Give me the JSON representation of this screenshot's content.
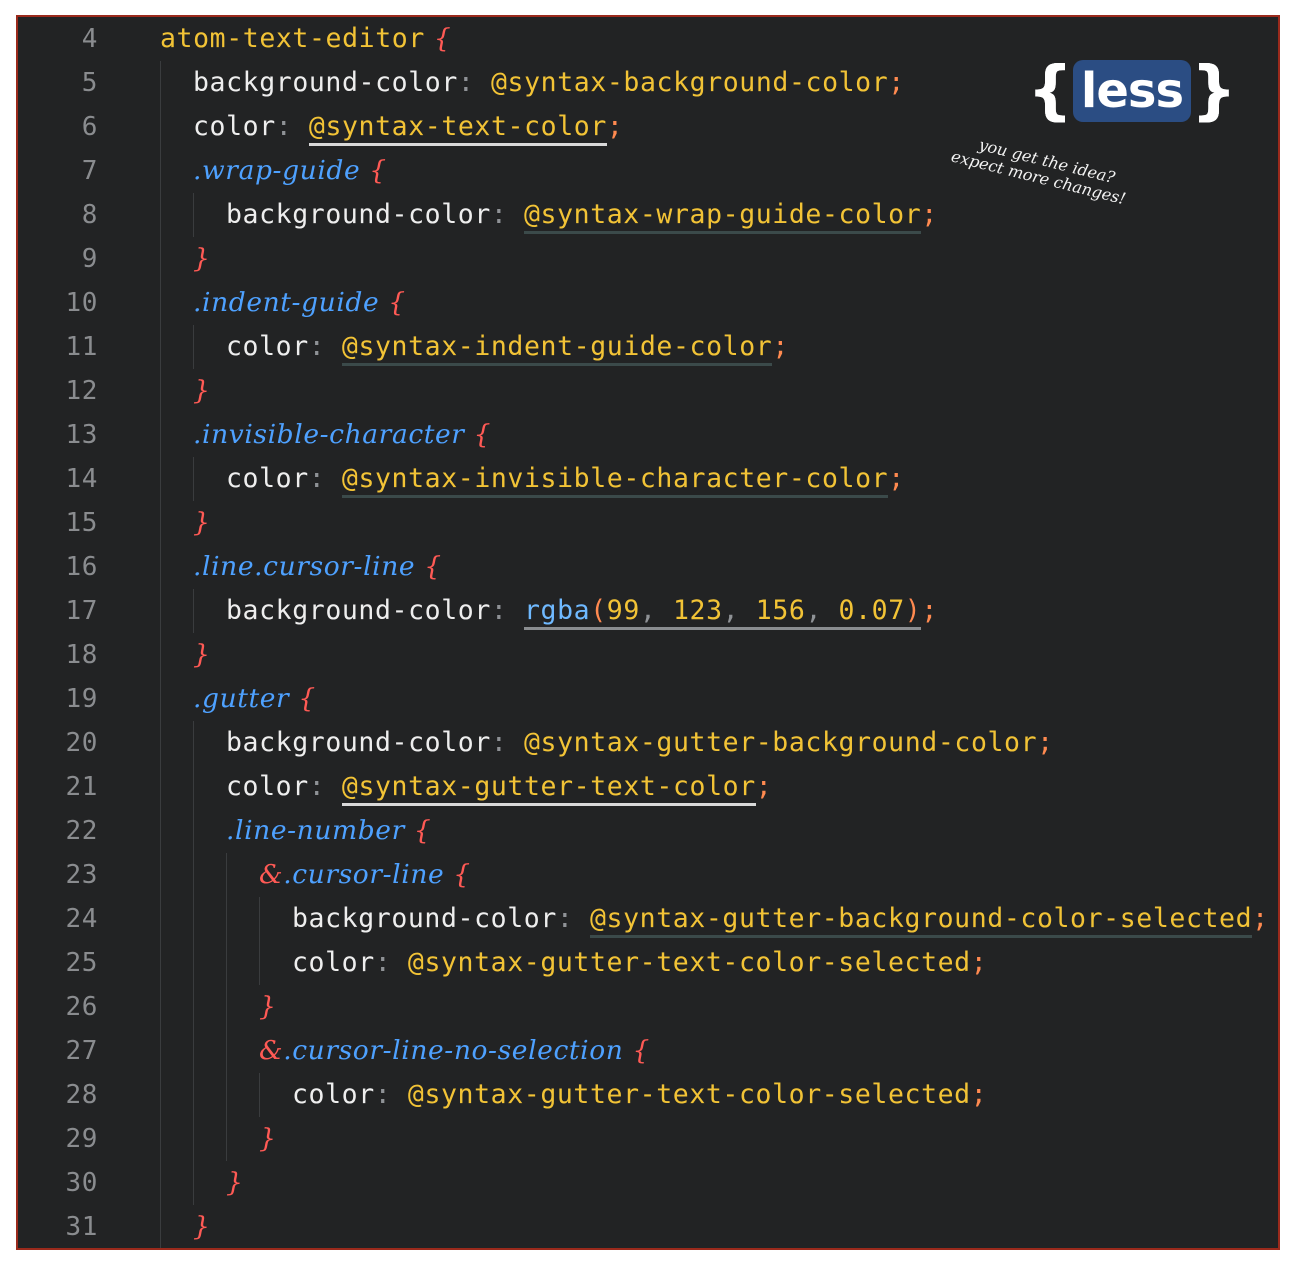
{
  "editor": {
    "lines": [
      {
        "n": "4",
        "indent": 0,
        "tokens": [
          [
            "prop-var",
            "atom-text-editor"
          ],
          [
            "brace",
            " {"
          ]
        ]
      },
      {
        "n": "5",
        "indent": 1,
        "tokens": [
          [
            "prop",
            "background-color"
          ],
          [
            "punc",
            ": "
          ],
          [
            "var",
            "@syntax-background-color"
          ],
          [
            "semi",
            ";"
          ]
        ]
      },
      {
        "n": "6",
        "indent": 1,
        "tokens": [
          [
            "prop",
            "color"
          ],
          [
            "punc",
            ": "
          ],
          [
            "var ul-white",
            "@syntax-text-color"
          ],
          [
            "semi",
            ";"
          ]
        ]
      },
      {
        "n": "7",
        "indent": 1,
        "tokens": [
          [
            "sel",
            ".wrap-guide"
          ],
          [
            "brace",
            " {"
          ]
        ]
      },
      {
        "n": "8",
        "indent": 2,
        "tokens": [
          [
            "prop",
            "background-color"
          ],
          [
            "punc",
            ": "
          ],
          [
            "var ul-dark",
            "@syntax-wrap-guide-color"
          ],
          [
            "semi",
            ";"
          ]
        ]
      },
      {
        "n": "9",
        "indent": 1,
        "tokens": [
          [
            "brace",
            "}"
          ]
        ]
      },
      {
        "n": "10",
        "indent": 1,
        "tokens": [
          [
            "sel",
            ".indent-guide"
          ],
          [
            "brace",
            " {"
          ]
        ]
      },
      {
        "n": "11",
        "indent": 2,
        "tokens": [
          [
            "prop",
            "color"
          ],
          [
            "punc",
            ": "
          ],
          [
            "var ul-dark",
            "@syntax-indent-guide-color"
          ],
          [
            "semi",
            ";"
          ]
        ]
      },
      {
        "n": "12",
        "indent": 1,
        "tokens": [
          [
            "brace",
            "}"
          ]
        ]
      },
      {
        "n": "13",
        "indent": 1,
        "tokens": [
          [
            "sel",
            ".invisible-character"
          ],
          [
            "brace",
            " {"
          ]
        ]
      },
      {
        "n": "14",
        "indent": 2,
        "tokens": [
          [
            "prop",
            "color"
          ],
          [
            "punc",
            ": "
          ],
          [
            "var ul-dark",
            "@syntax-invisible-character-color"
          ],
          [
            "semi",
            ";"
          ]
        ]
      },
      {
        "n": "15",
        "indent": 1,
        "tokens": [
          [
            "brace",
            "}"
          ]
        ]
      },
      {
        "n": "16",
        "indent": 1,
        "tokens": [
          [
            "sel",
            ".line.cursor-line"
          ],
          [
            "brace",
            " {"
          ]
        ]
      },
      {
        "n": "17",
        "indent": 2,
        "tokens": [
          [
            "prop",
            "background-color"
          ],
          [
            "punc",
            ": "
          ],
          [
            "fn ul-fn",
            "rgba"
          ],
          [
            "paren ul-fn",
            "("
          ],
          [
            "num ul-fn",
            "99"
          ],
          [
            "punc ul-fn",
            ", "
          ],
          [
            "num ul-fn",
            "123"
          ],
          [
            "punc ul-fn",
            ", "
          ],
          [
            "num ul-fn",
            "156"
          ],
          [
            "punc ul-fn",
            ", "
          ],
          [
            "num ul-fn",
            "0.07"
          ],
          [
            "paren ul-fn",
            ")"
          ],
          [
            "semi",
            ";"
          ]
        ]
      },
      {
        "n": "18",
        "indent": 1,
        "tokens": [
          [
            "brace",
            "}"
          ]
        ]
      },
      {
        "n": "19",
        "indent": 1,
        "tokens": [
          [
            "sel",
            ".gutter"
          ],
          [
            "brace",
            " {"
          ]
        ]
      },
      {
        "n": "20",
        "indent": 2,
        "tokens": [
          [
            "prop",
            "background-color"
          ],
          [
            "punc",
            ": "
          ],
          [
            "var",
            "@syntax-gutter-background-color"
          ],
          [
            "semi",
            ";"
          ]
        ]
      },
      {
        "n": "21",
        "indent": 2,
        "tokens": [
          [
            "prop",
            "color"
          ],
          [
            "punc",
            ": "
          ],
          [
            "var ul-white",
            "@syntax-gutter-text-color"
          ],
          [
            "semi",
            ";"
          ]
        ]
      },
      {
        "n": "22",
        "indent": 2,
        "tokens": [
          [
            "sel",
            ".line-number"
          ],
          [
            "brace",
            " {"
          ]
        ]
      },
      {
        "n": "23",
        "indent": 3,
        "tokens": [
          [
            "amp",
            "&"
          ],
          [
            "sel",
            ".cursor-line"
          ],
          [
            "brace",
            " {"
          ]
        ]
      },
      {
        "n": "24",
        "indent": 4,
        "tokens": [
          [
            "prop",
            "background-color"
          ],
          [
            "punc",
            ": "
          ],
          [
            "var ul-dark",
            "@syntax-gutter-background-color-selected"
          ],
          [
            "semi",
            ";"
          ]
        ]
      },
      {
        "n": "25",
        "indent": 4,
        "tokens": [
          [
            "prop",
            "color"
          ],
          [
            "punc",
            ": "
          ],
          [
            "var",
            "@syntax-gutter-text-color-selected"
          ],
          [
            "semi",
            ";"
          ]
        ]
      },
      {
        "n": "26",
        "indent": 3,
        "tokens": [
          [
            "brace",
            "}"
          ]
        ]
      },
      {
        "n": "27",
        "indent": 3,
        "tokens": [
          [
            "amp",
            "&"
          ],
          [
            "sel",
            ".cursor-line-no-selection"
          ],
          [
            "brace",
            " {"
          ]
        ]
      },
      {
        "n": "28",
        "indent": 4,
        "tokens": [
          [
            "prop",
            "color"
          ],
          [
            "punc",
            ": "
          ],
          [
            "var",
            "@syntax-gutter-text-color-selected"
          ],
          [
            "semi",
            ";"
          ]
        ]
      },
      {
        "n": "29",
        "indent": 3,
        "tokens": [
          [
            "brace",
            "}"
          ]
        ]
      },
      {
        "n": "30",
        "indent": 2,
        "tokens": [
          [
            "brace",
            "}"
          ]
        ]
      },
      {
        "n": "31",
        "indent": 1,
        "tokens": [
          [
            "brace",
            "}"
          ]
        ]
      }
    ]
  },
  "logo": {
    "left_brace": "{",
    "word": "less",
    "right_brace": "}"
  },
  "note": {
    "line1": "you get the idea?",
    "line2": "expect more changes!"
  },
  "colors": {
    "background": "#222324",
    "border": "#9b2a1c",
    "property": "#eeeeee",
    "variable": "#f2c336",
    "selector": "#4ea1ff",
    "brace": "#ff5a55"
  }
}
